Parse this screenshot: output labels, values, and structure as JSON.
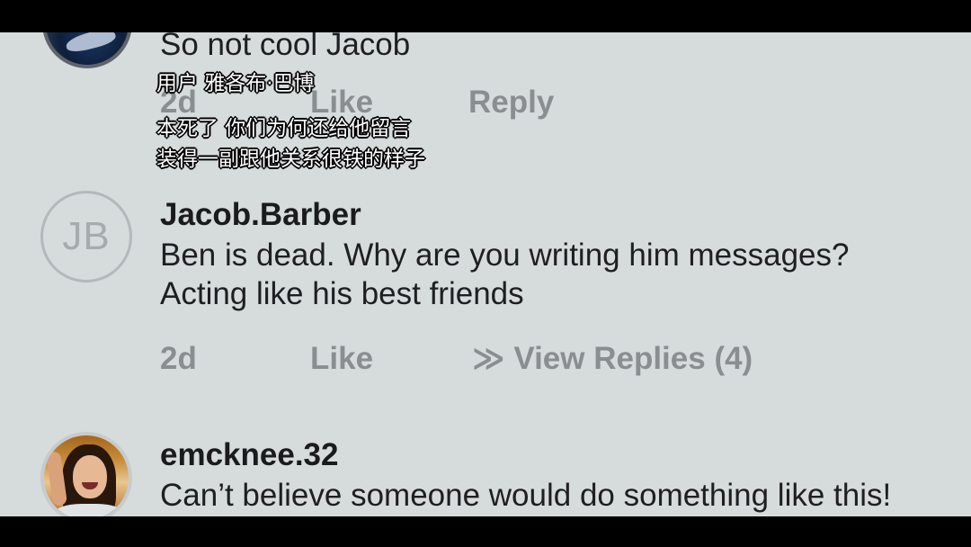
{
  "comments": [
    {
      "text": "So not cool Jacob",
      "time": "2d",
      "like_label": "Like",
      "reply_label": "Reply"
    },
    {
      "username": "Jacob.Barber",
      "avatar_initials": "JB",
      "text_line1": "Ben is dead. Why are you writing him messages?",
      "text_line2": "Acting like his best friends",
      "time": "2d",
      "like_label": "Like",
      "view_replies_label": "≫ View Replies (4)"
    },
    {
      "username": "emcknee.32",
      "text": "Can’t believe someone would do something like this!"
    }
  ],
  "subtitles": {
    "line1": "用户  雅各布·巴博",
    "line2": "本死了  你们为何还给他留言",
    "line3": "装得一副跟他关系很铁的样子"
  },
  "colors": {
    "background": "#d6dbdc",
    "meta_text": "#8a8e91",
    "body_text": "#1e1f21"
  }
}
